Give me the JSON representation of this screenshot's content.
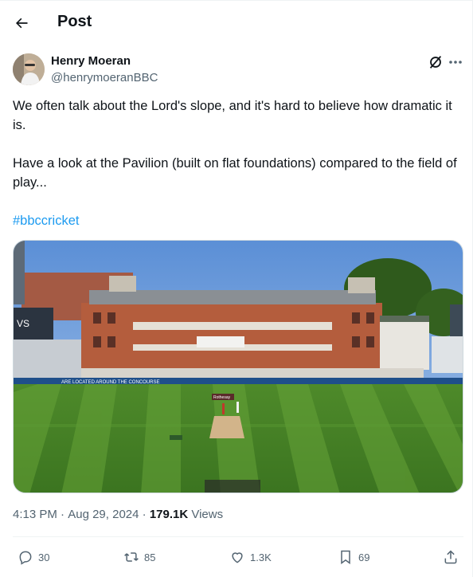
{
  "header": {
    "title": "Post",
    "back_icon": "arrow-left-icon"
  },
  "author": {
    "name": "Henry Moeran",
    "handle": "@henrymoeranBBC"
  },
  "post": {
    "line1": "We often talk about the Lord's slope, and it's hard to believe how dramatic it is.",
    "line2": "Have a look at the Pavilion (built on flat foundations) compared to the field of play...",
    "hashtag": "#bbccricket"
  },
  "media": {
    "board_text": "Rothesay",
    "ad_text": "ARE LOCATED AROUND THE CONCOURSE",
    "sign_text": "VS"
  },
  "meta": {
    "time": "4:13 PM",
    "date": "Aug 29, 2024",
    "views_count": "179.1K",
    "views_label": "Views"
  },
  "actions": {
    "replies": "30",
    "reposts": "85",
    "likes": "1.3K",
    "bookmarks": "69"
  },
  "colors": {
    "link": "#1d9bf0",
    "muted": "#536471",
    "text": "#0f1419"
  }
}
